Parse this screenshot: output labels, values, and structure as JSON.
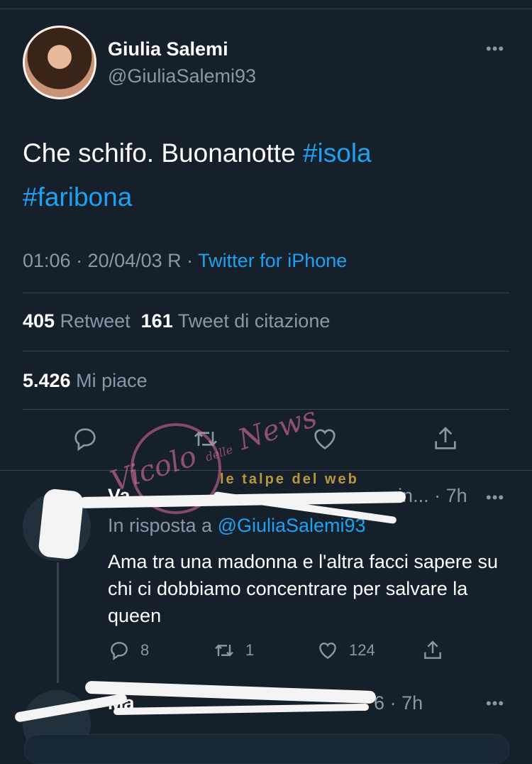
{
  "colors": {
    "background": "#15202b",
    "divider": "#38444d",
    "muted": "#8899a6",
    "link": "#1da1f2",
    "text": "#ffffff"
  },
  "tweet": {
    "author_name": "Giulia Salemi",
    "author_handle": "@GiuliaSalemi93",
    "more_icon": "more-dots-icon",
    "text_plain": "Che schifo. Buonanotte ",
    "hashtag1": "#isola",
    "hashtag2": "#faribona",
    "time_date": "01:06 · 20/04/03 R · ",
    "source": "Twitter for iPhone",
    "retweets_count": "405",
    "retweets_label": "Retweet",
    "quotes_count": "161",
    "quotes_label": "Tweet di citazione",
    "likes_count": "5.426",
    "likes_label": "Mi piace",
    "actions": [
      "reply-icon",
      "retweet-icon",
      "like-icon",
      "share-icon"
    ]
  },
  "reply": {
    "author_visible": "Va",
    "handle_tail": "in...",
    "time": "· 7h",
    "in_reply_label": "In risposta a ",
    "in_reply_handle": "@GiuliaSalemi93",
    "text": "Ama tra una madonna e l'altra facci sapere su chi ci dobbiamo concentrare per salvare la queen",
    "reply_count": "8",
    "retweet_count": "1",
    "like_count": "124"
  },
  "reply2": {
    "author_visible": "Ma",
    "handle_tail": "6",
    "time": "· 7h"
  },
  "watermark": {
    "script": "Vicolo",
    "small": "delle",
    "script2": "News",
    "banner": "le talpe del web"
  }
}
